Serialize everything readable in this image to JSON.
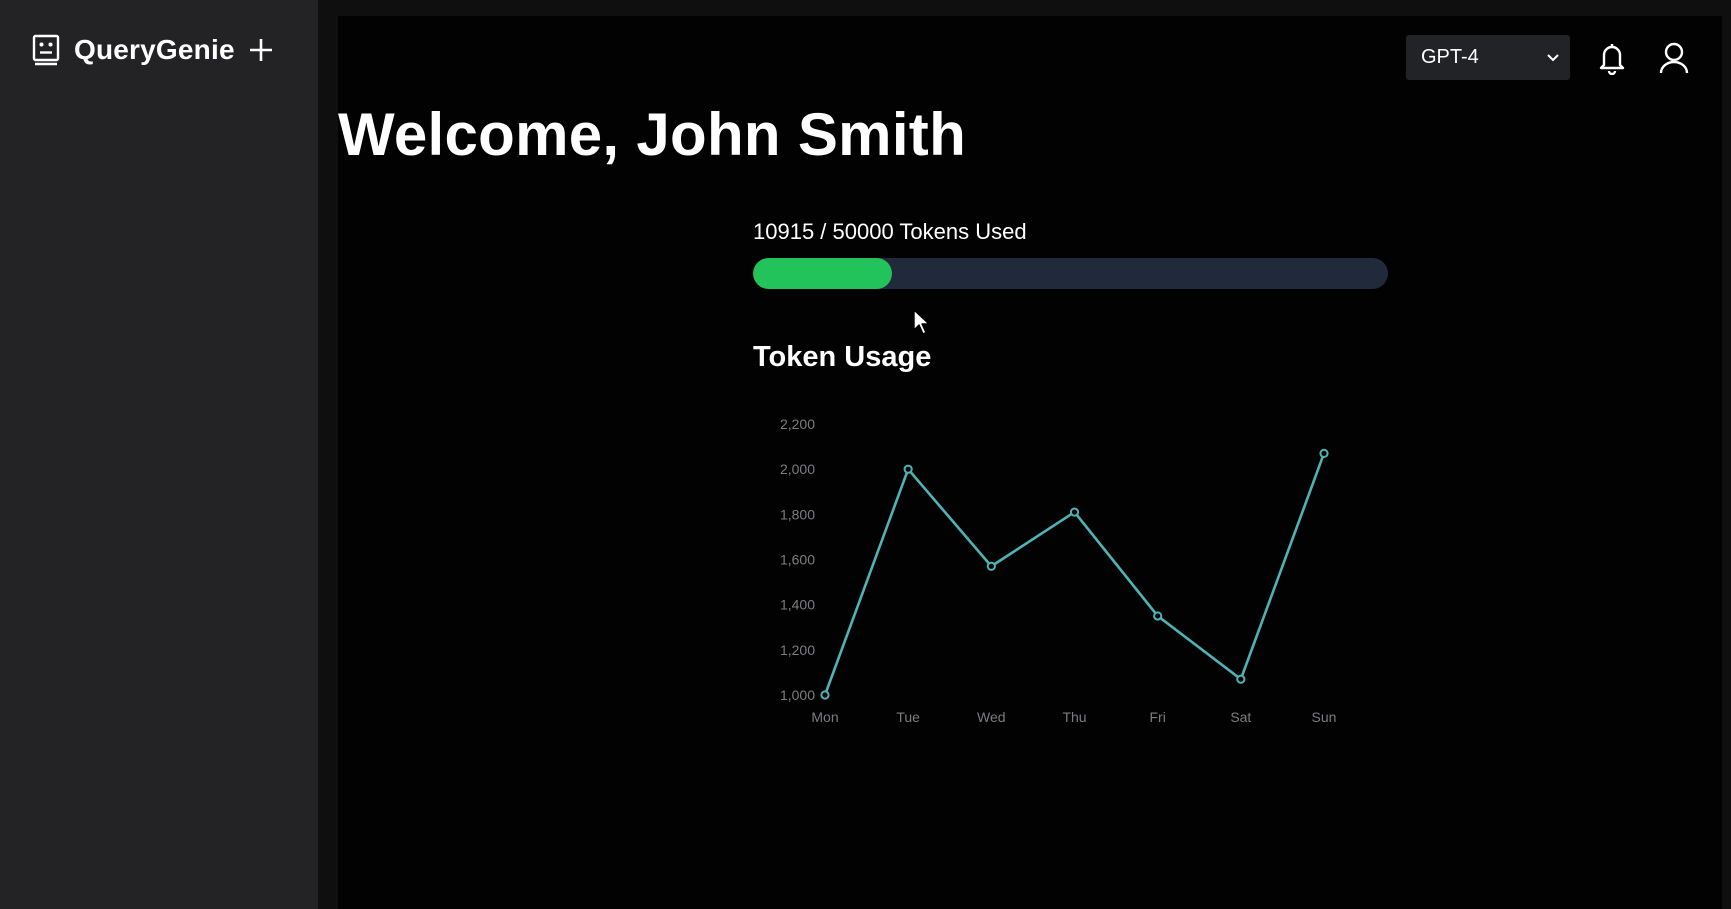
{
  "app": {
    "brand_name": "QueryGenie",
    "icons": {
      "brand": "robot-face-icon",
      "new_chat": "plus-icon",
      "dropdown": "chevron-down-icon",
      "notifications": "bell-icon",
      "account": "user-icon"
    }
  },
  "header": {
    "model_selected": "GPT-4"
  },
  "main": {
    "welcome": "Welcome, John Smith",
    "usage_text": "10915 / 50000 Tokens Used",
    "usage_used": 10915,
    "usage_limit": 50000,
    "chart_title": "Token Usage"
  },
  "colors": {
    "sidebar_bg": "#232326",
    "main_bg": "#020202",
    "progress_fill": "#23c35c",
    "progress_track": "#212a3a",
    "line": "#4fb3b5",
    "tick_text": "#7c7c80"
  },
  "chart_data": {
    "type": "line",
    "title": "Token Usage",
    "categories": [
      "Mon",
      "Tue",
      "Wed",
      "Thu",
      "Fri",
      "Sat",
      "Sun"
    ],
    "series": [
      {
        "values": [
          1000,
          2000,
          1570,
          1810,
          1350,
          1070,
          2070
        ]
      }
    ],
    "yticks": [
      "1,000",
      "1,200",
      "1,400",
      "1,600",
      "1,800",
      "2,000",
      "2,200"
    ],
    "ylim": [
      1000,
      2200
    ],
    "grid": false,
    "legend": "none"
  }
}
